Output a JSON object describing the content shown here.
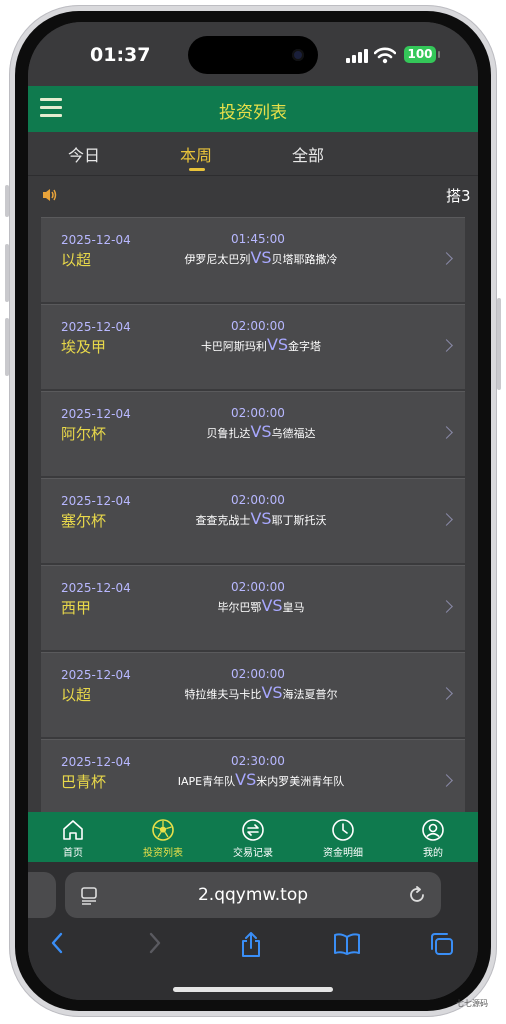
{
  "status_bar": {
    "time": "01:37",
    "battery": "100"
  },
  "header": {
    "title": "投资列表"
  },
  "tabs": [
    {
      "label": "今日"
    },
    {
      "label": "本周"
    },
    {
      "label": "全部"
    }
  ],
  "notice": {
    "text": "搭3"
  },
  "matches": [
    {
      "date": "2025-12-04",
      "league": "以超",
      "time": "01:45:00",
      "home": "伊罗尼太巴列",
      "vs": "VS",
      "away": "贝塔耶路撒冷"
    },
    {
      "date": "2025-12-04",
      "league": "埃及甲",
      "time": "02:00:00",
      "home": "卡巴阿斯玛利",
      "vs": "VS",
      "away": "金字塔"
    },
    {
      "date": "2025-12-04",
      "league": "阿尔杯",
      "time": "02:00:00",
      "home": "贝鲁扎达",
      "vs": "VS",
      "away": "乌德福达"
    },
    {
      "date": "2025-12-04",
      "league": "塞尔杯",
      "time": "02:00:00",
      "home": "查查克战士",
      "vs": "VS",
      "away": "耶丁斯托沃"
    },
    {
      "date": "2025-12-04",
      "league": "西甲",
      "time": "02:00:00",
      "home": "毕尔巴鄂",
      "vs": "VS",
      "away": "皇马"
    },
    {
      "date": "2025-12-04",
      "league": "以超",
      "time": "02:00:00",
      "home": "特拉维夫马卡比",
      "vs": "VS",
      "away": "海法夏普尔"
    },
    {
      "date": "2025-12-04",
      "league": "巴青杯",
      "time": "02:30:00",
      "home": "IAPE青年队",
      "vs": "VS",
      "away": "米内罗美洲青年队"
    }
  ],
  "bottom_nav": [
    {
      "label": "首页",
      "icon": "home-icon"
    },
    {
      "label": "投资列表",
      "icon": "soccer-ball-icon"
    },
    {
      "label": "交易记录",
      "icon": "exchange-icon"
    },
    {
      "label": "资金明细",
      "icon": "clock-icon"
    },
    {
      "label": "我的",
      "icon": "user-icon"
    }
  ],
  "browser": {
    "url": "2.qqymw.top"
  },
  "watermark": "七七源码",
  "colors": {
    "header": "#0f7a4e",
    "accent": "#e8c23a",
    "league": "#e8d84a",
    "date": "#b8b8ff"
  }
}
